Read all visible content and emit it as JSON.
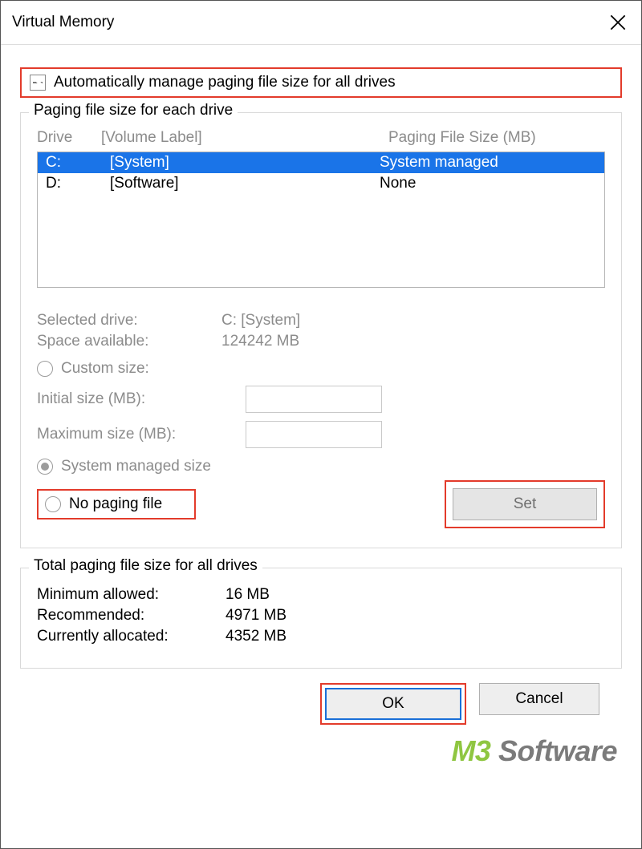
{
  "title": "Virtual Memory",
  "auto_manage_label": "Automatically manage paging file size for all drives",
  "group1": {
    "legend": "Paging file size for each drive",
    "header_drive": "Drive",
    "header_volume": "[Volume Label]",
    "header_size": "Paging File Size (MB)",
    "rows": [
      {
        "drive": "C:",
        "label": "[System]",
        "size": "System managed",
        "selected": true
      },
      {
        "drive": "D:",
        "label": "[Software]",
        "size": "None",
        "selected": false
      }
    ],
    "selected_drive_label": "Selected drive:",
    "selected_drive_value": "C:  [System]",
    "space_label": "Space available:",
    "space_value": "124242 MB",
    "custom_size_label": "Custom size:",
    "initial_label": "Initial size (MB):",
    "max_label": "Maximum size (MB):",
    "system_managed_label": "System managed size",
    "no_paging_label": "No paging file",
    "set_label": "Set"
  },
  "group2": {
    "legend": "Total paging file size for all drives",
    "min_label": "Minimum allowed:",
    "min_value": "16 MB",
    "rec_label": "Recommended:",
    "rec_value": "4971 MB",
    "cur_label": "Currently allocated:",
    "cur_value": "4352 MB"
  },
  "buttons": {
    "ok": "OK",
    "cancel": "Cancel"
  },
  "watermark": {
    "m3": "M3",
    "soft": " Software"
  }
}
